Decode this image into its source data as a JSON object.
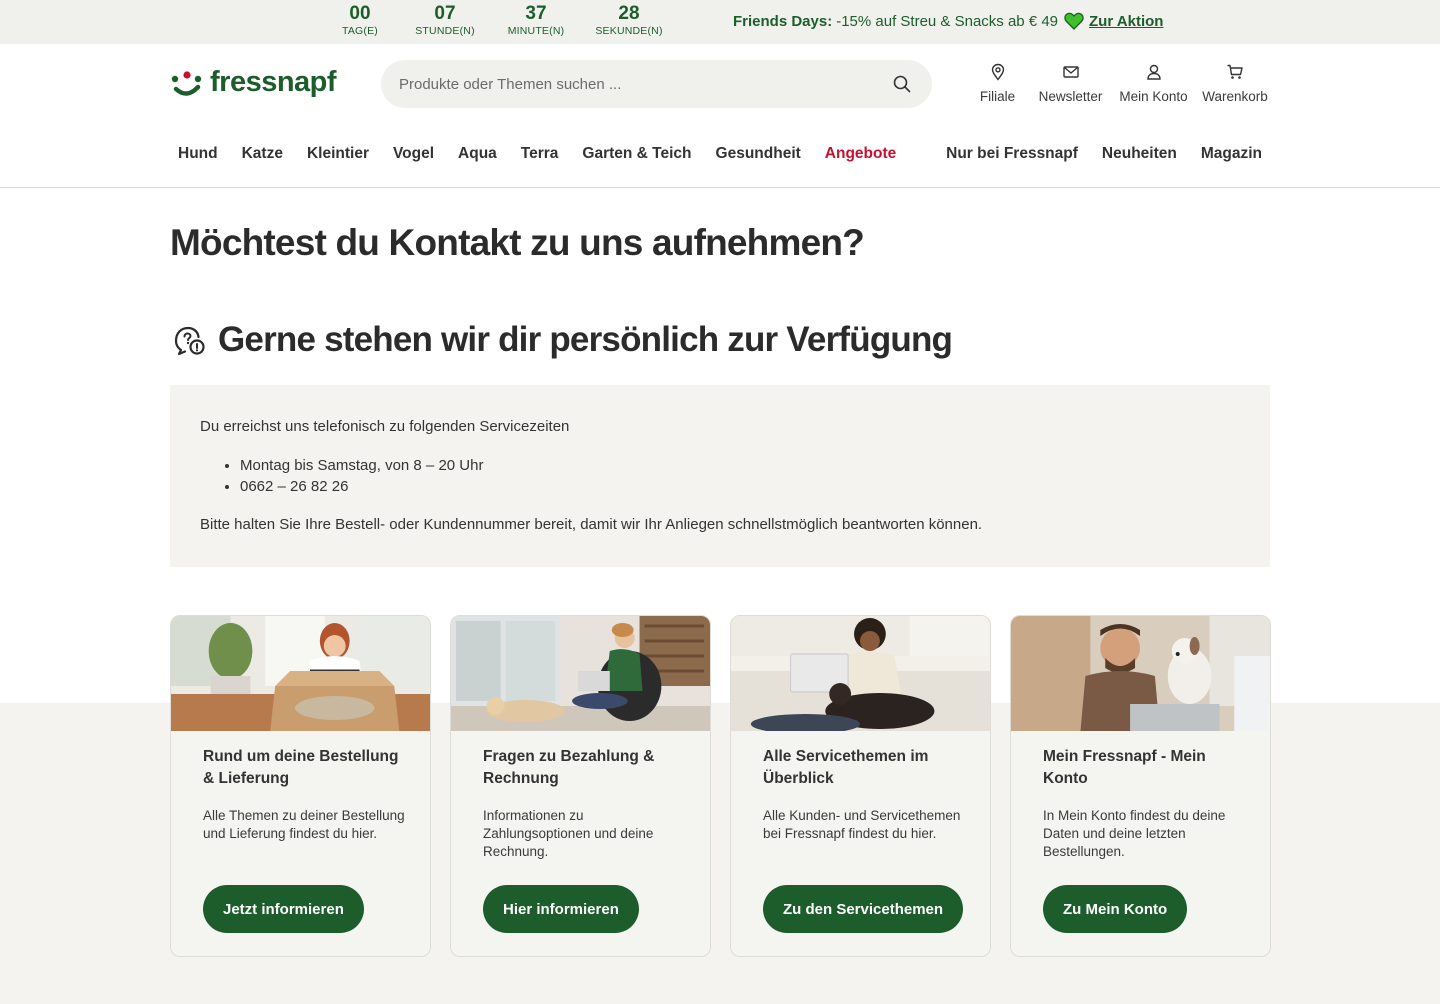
{
  "promo": {
    "countdown": [
      {
        "value": "00",
        "label": "TAG(E)"
      },
      {
        "value": "07",
        "label": "STUNDE(N)"
      },
      {
        "value": "37",
        "label": "MINUTE(N)"
      },
      {
        "value": "28",
        "label": "SEKUNDE(N)"
      }
    ],
    "title": "Friends Days:",
    "text": "-15% auf Streu & Snacks ab € 49",
    "link": "Zur Aktion",
    "heart_color": "#3fbf2a"
  },
  "header": {
    "logo": "fressnapf",
    "search_placeholder": "Produkte oder Themen suchen ...",
    "actions": [
      {
        "label": "Filiale",
        "icon": "location-pin-icon"
      },
      {
        "label": "Newsletter",
        "icon": "mail-icon"
      },
      {
        "label": "Mein Konto",
        "icon": "user-icon"
      },
      {
        "label": "Warenkorb",
        "icon": "cart-icon"
      }
    ]
  },
  "nav": {
    "left": [
      "Hund",
      "Katze",
      "Kleintier",
      "Vogel",
      "Aqua",
      "Terra",
      "Garten & Teich",
      "Gesundheit",
      "Angebote"
    ],
    "right": [
      "Nur bei Fressnapf",
      "Neuheiten",
      "Magazin"
    ]
  },
  "main": {
    "title": "Möchtest du Kontakt zu uns aufnehmen?",
    "subtitle": "Gerne stehen wir dir persönlich zur Verfügung",
    "info_intro": "Du erreichst uns telefonisch zu folgenden Servicezeiten",
    "info_items": [
      "Montag bis Samstag, von 8 – 20 Uhr",
      "0662 – 26 82 26"
    ],
    "info_outro": "Bitte halten Sie Ihre Bestell- oder Kundennummer bereit, damit wir Ihr Anliegen schnellstmöglich beantworten können."
  },
  "cards": [
    {
      "title": "Rund um deine Bestellung & Lieferung",
      "desc": "Alle Themen zu deiner Bestellung und Lieferung findest du hier.",
      "button": "Jetzt informieren"
    },
    {
      "title": "Fragen zu Bezahlung & Rechnung",
      "desc": "Informationen zu Zahlungsoptionen und deine Rechnung.",
      "button": "Hier informieren"
    },
    {
      "title": "Alle Servicethemen im Überblick",
      "desc": "Alle Kunden- und Servicethemen bei Fressnapf findest du hier.",
      "button": "Zu den Servicethemen"
    },
    {
      "title": "Mein Fressnapf - Mein Konto",
      "desc": "In Mein Konto findest du deine Daten und deine letzten Bestellungen.",
      "button": "Zu Mein Konto"
    }
  ]
}
